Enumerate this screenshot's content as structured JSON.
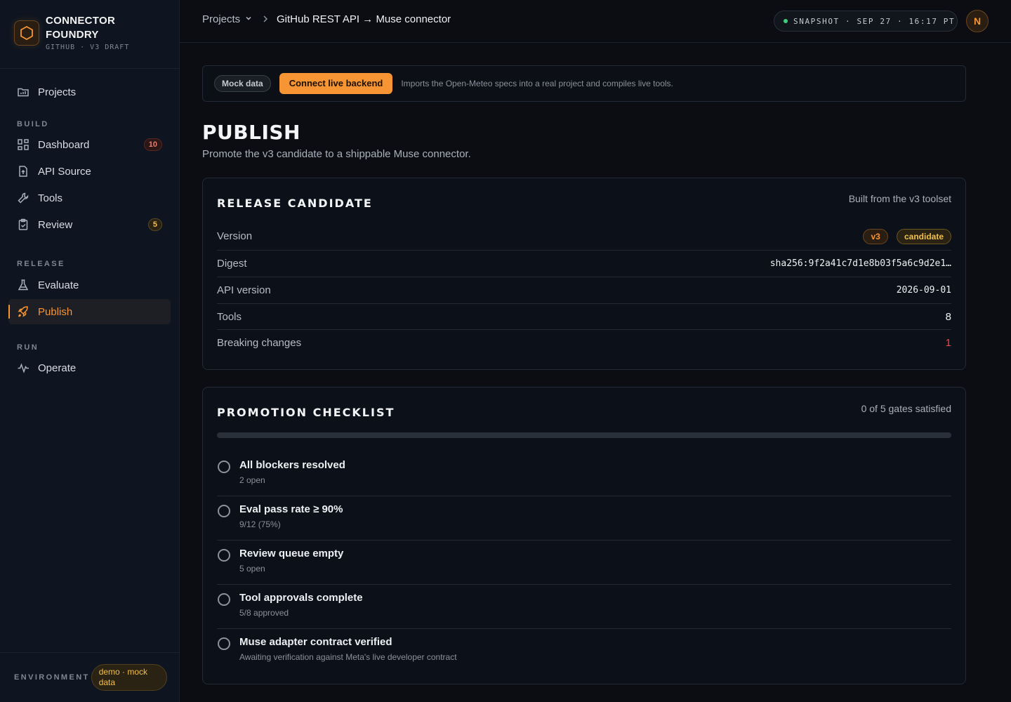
{
  "brand": {
    "title": "CONNECTOR FOUNDRY",
    "subtitle": "GITHUB · V3 DRAFT"
  },
  "sidebar": {
    "projects_label": "Projects",
    "sections": {
      "build": "BUILD",
      "release": "RELEASE",
      "run": "RUN"
    },
    "items": {
      "dashboard": {
        "label": "Dashboard",
        "badge": "10"
      },
      "api_source": {
        "label": "API Source"
      },
      "tools": {
        "label": "Tools"
      },
      "review": {
        "label": "Review",
        "badge": "5"
      },
      "evaluate": {
        "label": "Evaluate"
      },
      "publish": {
        "label": "Publish"
      },
      "operate": {
        "label": "Operate"
      }
    },
    "environment": {
      "label": "ENVIRONMENT",
      "value": "demo · mock data"
    }
  },
  "topbar": {
    "crumb_projects": "Projects",
    "crumb_current": "GitHub REST API → Muse connector",
    "snapshot": "SNAPSHOT · SEP 27 · 16:17 PT",
    "avatar_initial": "N"
  },
  "banner": {
    "mock_label": "Mock data",
    "connect_label": "Connect live backend",
    "note": "Imports the Open-Meteo specs into a real project and compiles live tools."
  },
  "page": {
    "title": "PUBLISH",
    "subtitle": "Promote the v3 candidate to a shippable Muse connector."
  },
  "release_candidate": {
    "title": "RELEASE CANDIDATE",
    "meta": "Built from the v3 toolset",
    "version_label": "Version",
    "version_tag": "v3",
    "status_tag": "candidate",
    "digest_label": "Digest",
    "digest_value": "sha256:9f2a41c7d1e8b03f5a6c9d2e1…",
    "api_version_label": "API version",
    "api_version_value": "2026-09-01",
    "tools_label": "Tools",
    "tools_value": "8",
    "breaking_label": "Breaking changes",
    "breaking_value": "1"
  },
  "checklist": {
    "title": "PROMOTION CHECKLIST",
    "meta": "0 of 5 gates satisfied",
    "progress": 0,
    "items": [
      {
        "title": "All blockers resolved",
        "sub": "2 open"
      },
      {
        "title": "Eval pass rate ≥ 90%",
        "sub": "9/12 (75%)"
      },
      {
        "title": "Review queue empty",
        "sub": "5 open"
      },
      {
        "title": "Tool approvals complete",
        "sub": "5/8 approved"
      },
      {
        "title": "Muse adapter contract verified",
        "sub": "Awaiting verification against Meta's live developer contract"
      }
    ]
  },
  "colors": {
    "accent": "#f79433",
    "danger": "#e5484d",
    "success": "#3bd17a"
  }
}
